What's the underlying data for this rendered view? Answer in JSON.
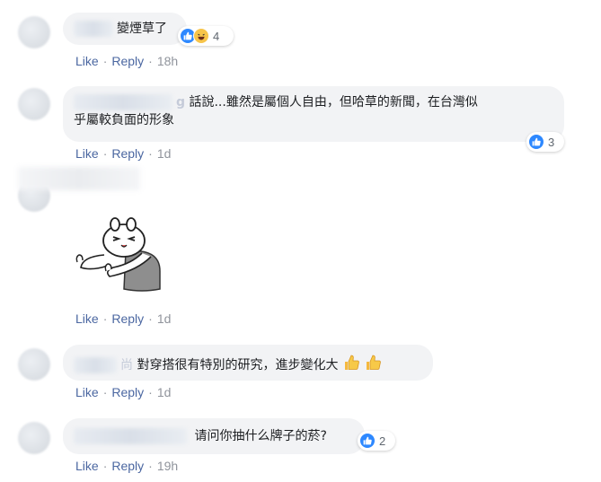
{
  "actions": {
    "like": "Like",
    "reply": "Reply",
    "sep": "·"
  },
  "comments": [
    {
      "text": "變煙草了",
      "time": "18h",
      "reactions": "4"
    },
    {
      "name_fragment": "g",
      "text_line1": "話說...雖然是屬個人自由，但哈草的新聞，在台灣似",
      "text_line2": "乎屬較負面的形象",
      "time": "1d",
      "reactions": "3"
    },
    {
      "sticker": "thumbs-up-bunny-sticker",
      "time": "1d"
    },
    {
      "name_fragment": "尚",
      "text": "對穿搭很有特別的研究，進步變化大",
      "time": "1d"
    },
    {
      "text": "请问你抽什么牌子的菸?",
      "time": "19h",
      "reactions": "2"
    }
  ],
  "colors": {
    "like_blue": "#2d88ff",
    "link": "#4b67a1",
    "meta": "#90949c",
    "bubble": "#f2f3f5"
  }
}
